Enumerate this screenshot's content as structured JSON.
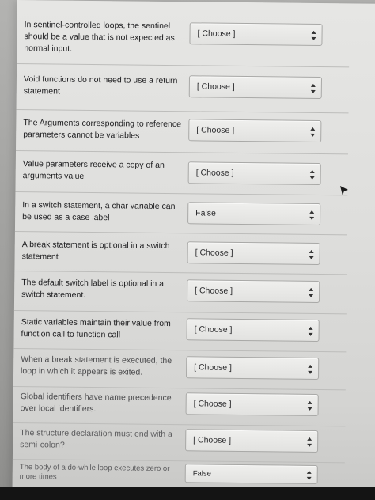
{
  "questions": [
    {
      "text": "In sentinel-controlled loops, the sentinel should be a value that is not expected as normal input.",
      "answer": "[ Choose ]"
    },
    {
      "text": "Void functions do not need to use a return statement",
      "answer": "[ Choose ]"
    },
    {
      "text": "The Arguments corresponding to reference parameters cannot be variables",
      "answer": "[ Choose ]"
    },
    {
      "text": "Value parameters receive a copy of an arguments value",
      "answer": "[ Choose ]"
    },
    {
      "text": "In a switch statement, a char variable can be used as a case label",
      "answer": "False"
    },
    {
      "text": "A break statement is optional in a switch statement",
      "answer": "[ Choose ]"
    },
    {
      "text": "The default switch label is optional in a switch statement.",
      "answer": "[ Choose ]"
    },
    {
      "text": "Static variables maintain their value from function call to function call",
      "answer": "[ Choose ]"
    },
    {
      "text": "When a break statement is executed, the loop in which it appears is exited.",
      "answer": "[ Choose ]"
    },
    {
      "text": "Global identifiers have name precedence over local identifiers.",
      "answer": "[ Choose ]"
    },
    {
      "text": "The structure declaration must end with a semi-colon?",
      "answer": "[ Choose ]"
    },
    {
      "text": "The body of a do-while loop executes zero or more times",
      "answer": "False"
    }
  ]
}
